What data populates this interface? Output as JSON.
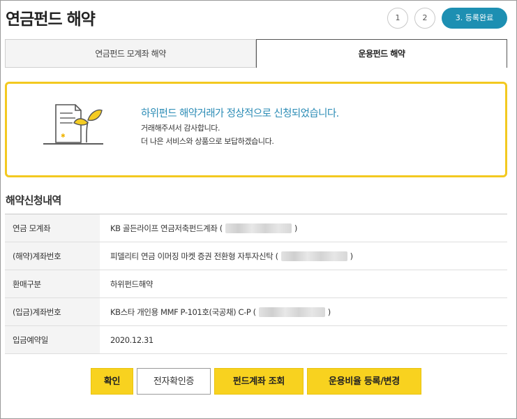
{
  "page": {
    "title": "연금펀드 해약"
  },
  "steps": [
    {
      "label": "1"
    },
    {
      "label": "2"
    },
    {
      "label": "3. 등록완료"
    }
  ],
  "tabs": [
    {
      "label": "연금펀드 모계좌 해약"
    },
    {
      "label": "운용펀드 해약"
    }
  ],
  "notice": {
    "title": "하위펀드 해약거래가 정상적으로 신청되었습니다.",
    "line1": "거래해주셔서 감사합니다.",
    "line2": "더 나은 서비스와 상품으로 보답하겠습니다."
  },
  "details": {
    "section_title": "해약신청내역",
    "rows": [
      {
        "label": "연금 모계좌",
        "value_before": "KB 골든라이프 연금저축펀드계좌 (",
        "value_after": ")"
      },
      {
        "label": "(해약)계좌번호",
        "value_before": "피델리티 연금 이머징 마켓 증권 전환형 자투자신탁 (",
        "value_after": ")"
      },
      {
        "label": "환매구분",
        "value": "하위펀드해약"
      },
      {
        "label": "(입금)계좌번호",
        "value_before": "KB스타 개인용 MMF P-101호(국공채) C-P (",
        "value_after": ")"
      },
      {
        "label": "입금예약일",
        "value": "2020.12.31"
      }
    ]
  },
  "buttons": {
    "confirm": "확인",
    "e_cert": "전자확인증",
    "fund_lookup": "펀드계좌 조회",
    "ratio_register": "운용비율 등록/변경"
  },
  "colors": {
    "accent_blue": "#1d8fb2",
    "notice_border": "#f3c920",
    "button_yellow": "#f8d21f"
  }
}
